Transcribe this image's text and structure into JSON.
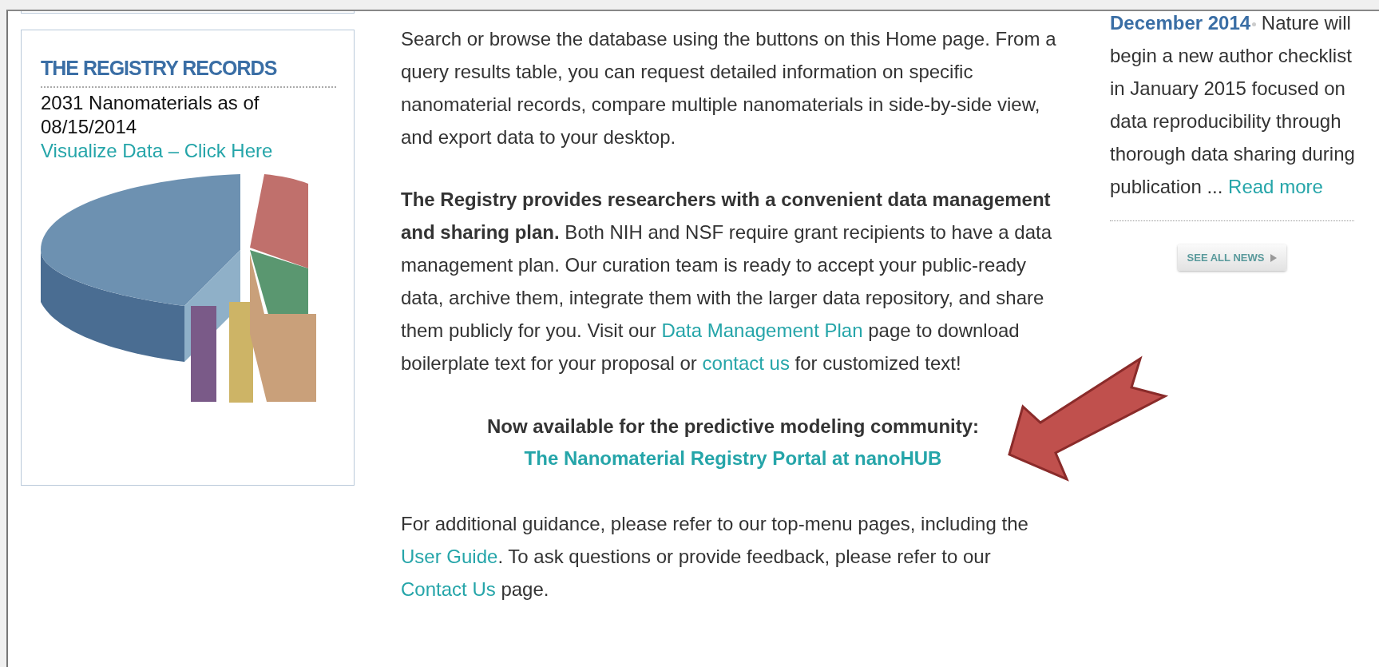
{
  "sidebar_card": {
    "title": "THE REGISTRY RECORDS",
    "count_text": "2031 Nanomaterials as of 08/15/2014",
    "link": "Visualize Data – Click Here"
  },
  "main": {
    "paragraphs": [
      {
        "parts": [
          {
            "kind": "text",
            "text": "Search or browse the database using the buttons on this Home page. From a query results table, you can request detailed information on specific nanomaterial records, compare multiple nanomaterials in side-by-side view, and export data to your desktop."
          }
        ]
      },
      {
        "parts": [
          {
            "kind": "text",
            "text": "**The Registry provides researchers with a convenient data management and sharing plan.** Both NIH and NSF require grant recipients to have a data management plan. Our curation team is ready to accept your public-ready data, archive them, integrate them with the larger data repository, and share them publicly for you. Visit our "
          },
          {
            "kind": "link",
            "text": "Data Management Plan"
          },
          {
            "kind": "text",
            "text": " page to download boilerplate text for your proposal or "
          },
          {
            "kind": "link",
            "text": "contact us"
          },
          {
            "kind": "text",
            "text": " for customized text!"
          }
        ]
      }
    ],
    "announcement": {
      "text": "Now available for the predictive modeling community:",
      "link": "The Nanomaterial Registry Portal at nanoHUB"
    },
    "closing": {
      "parts": [
        {
          "kind": "text",
          "text": "For additional guidance, please refer to our top-menu pages, including the "
        },
        {
          "kind": "link",
          "text": "User Guide"
        },
        {
          "kind": "text",
          "text": ". To ask questions or provide feedback, please refer to our "
        },
        {
          "kind": "link",
          "text": "Contact Us"
        },
        {
          "kind": "text",
          "text": " page."
        }
      ]
    }
  },
  "news": {
    "date": "December 2014",
    "text": " Nature will begin a new author checklist in January 2015 focused on data reproducibility through thorough data sharing during publication ... ",
    "link": "Read more",
    "button": "SEE ALL NEWS"
  }
}
